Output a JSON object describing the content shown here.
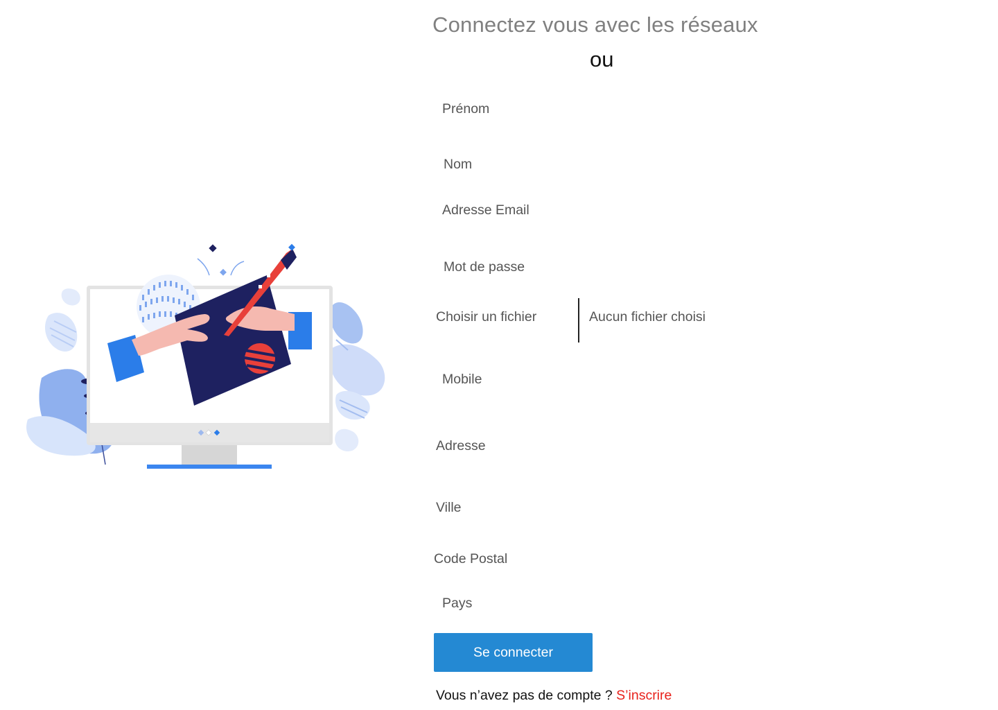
{
  "header": {
    "title": "Connectez vous avec les réseaux",
    "separator": "ou"
  },
  "form": {
    "first_name_placeholder": "Prénom",
    "last_name_placeholder": "Nom",
    "email_placeholder": "Adresse Email",
    "password_placeholder": "Mot de passe",
    "file_button_label": "Choisir un fichier",
    "file_status": "Aucun fichier choisi",
    "mobile_placeholder": "Mobile",
    "address_placeholder": "Adresse",
    "city_placeholder": "Ville",
    "postal_code_placeholder": "Code Postal",
    "country_placeholder": "Pays",
    "submit_label": "Se connecter"
  },
  "footer": {
    "prompt": "Vous n’avez pas de compte ? ",
    "signup_link": "S’inscrire"
  },
  "colors": {
    "primary_button": "#2489d3",
    "signup_link": "#e8211b",
    "heading_gray": "#808080",
    "illustration_navy": "#1e2160",
    "illustration_blue": "#2b7de9",
    "illustration_red": "#e8403a"
  }
}
